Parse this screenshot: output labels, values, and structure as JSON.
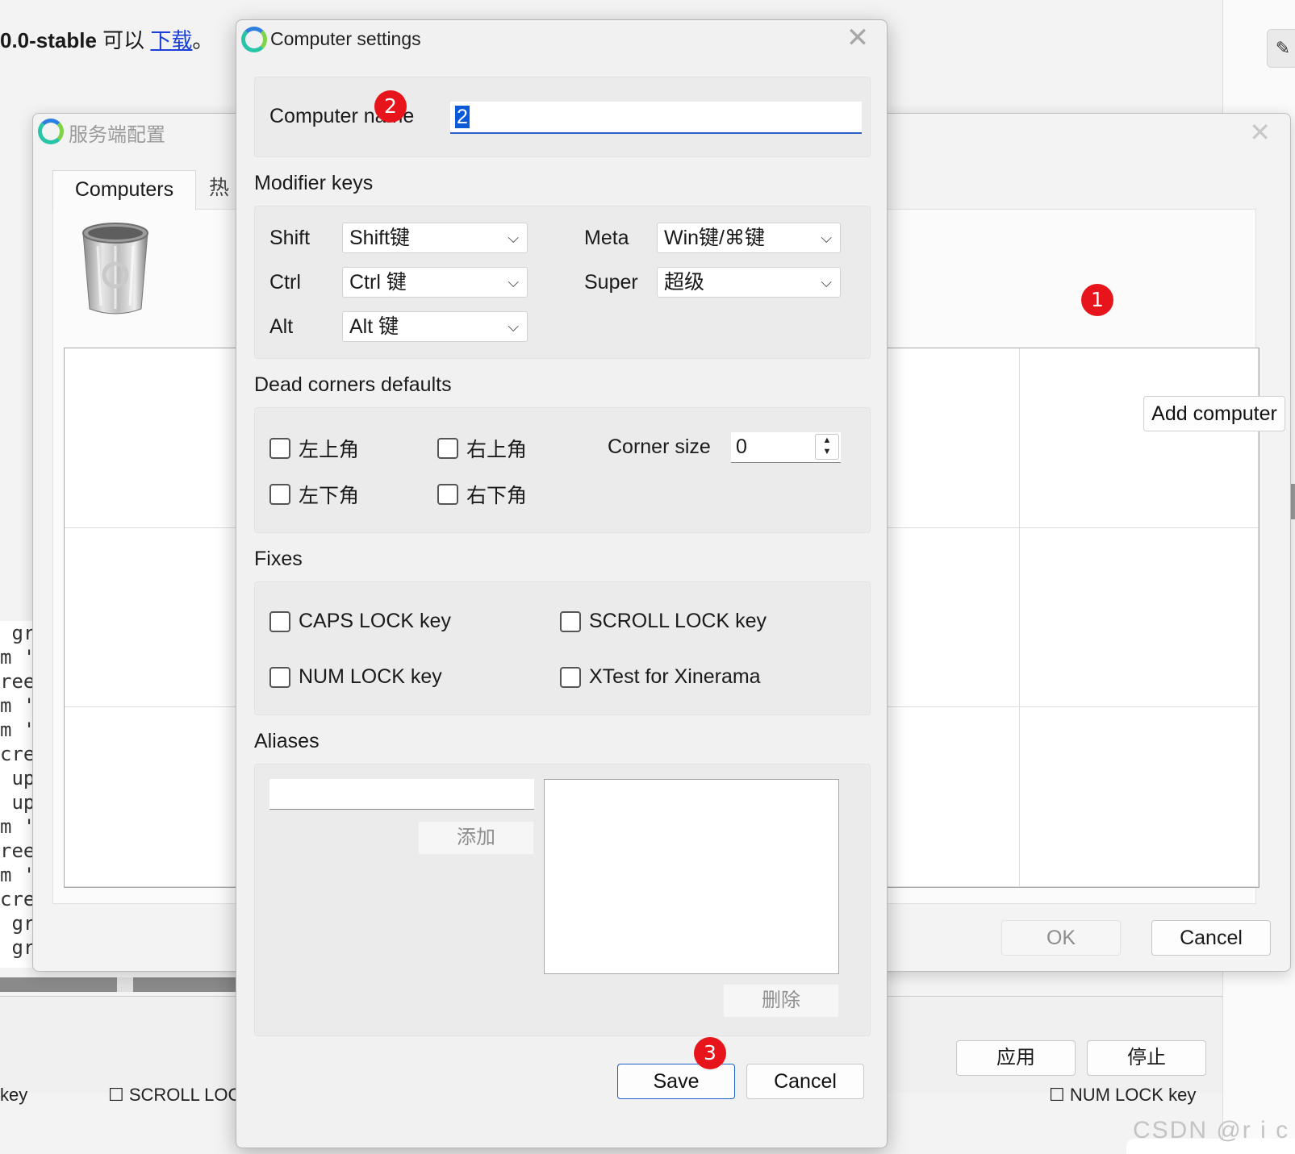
{
  "background": {
    "page_text_bold": "0.0-stable",
    "page_text_mid": " 可以 ",
    "page_link": "下载",
    "page_text_end": "。",
    "code_lines": [
      " gr",
      "m '",
      "ree",
      "m '",
      "m '",
      "cre",
      " up",
      " up",
      "m '",
      "ree",
      "m '",
      "cre",
      " gr",
      " gr"
    ],
    "bottom_left_text": "key",
    "bottom_scroll_lock_text": "SCROLL LOCK",
    "bottom_right_text": "NUM LOCK key",
    "apply_button": "应用",
    "stop_button": "停止",
    "watermark": "CSDN @r i c k",
    "right_button_icon": "magic-wand-icon"
  },
  "server_window": {
    "title": "服务端配置",
    "close": "✕",
    "tabs": [
      "Computers",
      "热"
    ],
    "add_computer_label": "Add computer",
    "ok_label": "OK",
    "cancel_label": "Cancel"
  },
  "dialog": {
    "title": "Computer settings",
    "close": "✕",
    "computer_name_label": "Computer name",
    "computer_name_value": "2",
    "modifier_section": "Modifier keys",
    "modifiers": {
      "shift_label": "Shift",
      "shift_value": "Shift键",
      "ctrl_label": "Ctrl",
      "ctrl_value": "Ctrl 键",
      "alt_label": "Alt",
      "alt_value": "Alt 键",
      "meta_label": "Meta",
      "meta_value": "Win键/⌘键",
      "super_label": "Super",
      "super_value": "超级"
    },
    "dead_corners_section": "Dead corners defaults",
    "corners": {
      "top_left": "左上角",
      "top_right": "右上角",
      "bottom_left": "左下角",
      "bottom_right": "右下角",
      "corner_size_label": "Corner size",
      "corner_size_value": "0"
    },
    "fixes_section": "Fixes",
    "fixes": {
      "caps_lock": "CAPS LOCK key",
      "scroll_lock": "SCROLL LOCK key",
      "num_lock": "NUM LOCK key",
      "xtest": "XTest for Xinerama"
    },
    "aliases_section": "Aliases",
    "aliases": {
      "add_label": "添加",
      "delete_label": "删除"
    },
    "save_label": "Save",
    "cancel_label": "Cancel"
  },
  "markers": [
    "1",
    "2",
    "3"
  ],
  "colors": {
    "marker_red": "#e8141c",
    "selection_blue": "#0a5ad8",
    "focus_border": "#1d5fc8",
    "link_blue": "#1a3fd6"
  }
}
